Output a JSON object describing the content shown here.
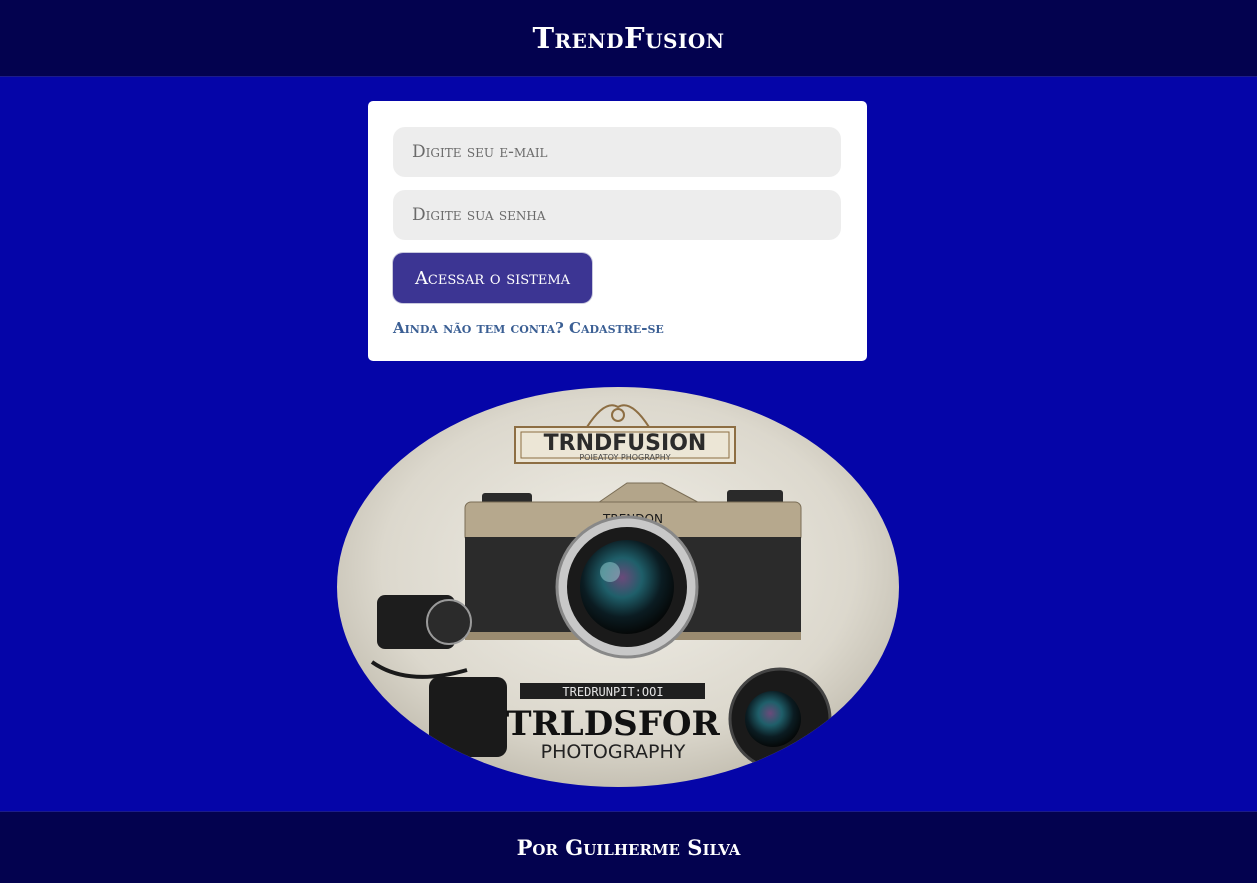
{
  "header": {
    "title": "TrendFusion"
  },
  "login": {
    "email_placeholder": "Digite seu e-mail",
    "password_placeholder": "Digite sua senha",
    "submit_label": "Acessar o sistema",
    "signup_link": "Ainda não tem conta? Cadastre-se"
  },
  "logo_image": {
    "badge_text": "TRNDFUSION",
    "badge_subtext": "POIEATOY PHOGRAPHY",
    "camera_brand": "TRENDON",
    "plate_text": "TREDRUNPIT:OOI",
    "big_text": "TRLDSFOR",
    "bottom_text": "PHOTOGRAPHY"
  },
  "footer": {
    "text": "Por Guilherme Silva"
  },
  "colors": {
    "page_background": "#0505a8",
    "header_footer_background": "#03024f",
    "button_background": "#3c3593",
    "link_color": "#3b5f94"
  }
}
